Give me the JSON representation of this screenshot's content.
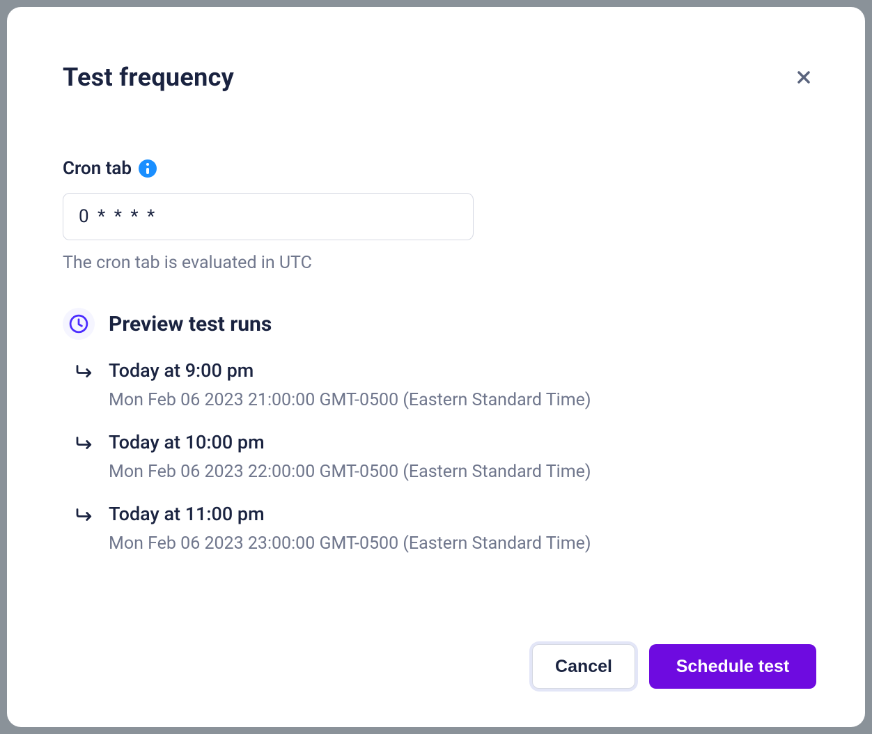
{
  "modal": {
    "title": "Test frequency",
    "cron": {
      "label": "Cron tab",
      "value": "0 * * * *",
      "helper": "The cron tab is evaluated in UTC"
    },
    "preview": {
      "title": "Preview test runs",
      "items": [
        {
          "time": "Today at 9:00 pm",
          "full": "Mon Feb 06 2023 21:00:00 GMT-0500 (Eastern Standard Time)"
        },
        {
          "time": "Today at 10:00 pm",
          "full": "Mon Feb 06 2023 22:00:00 GMT-0500 (Eastern Standard Time)"
        },
        {
          "time": "Today at 11:00 pm",
          "full": "Mon Feb 06 2023 23:00:00 GMT-0500 (Eastern Standard Time)"
        }
      ]
    },
    "buttons": {
      "cancel": "Cancel",
      "schedule": "Schedule test"
    }
  }
}
